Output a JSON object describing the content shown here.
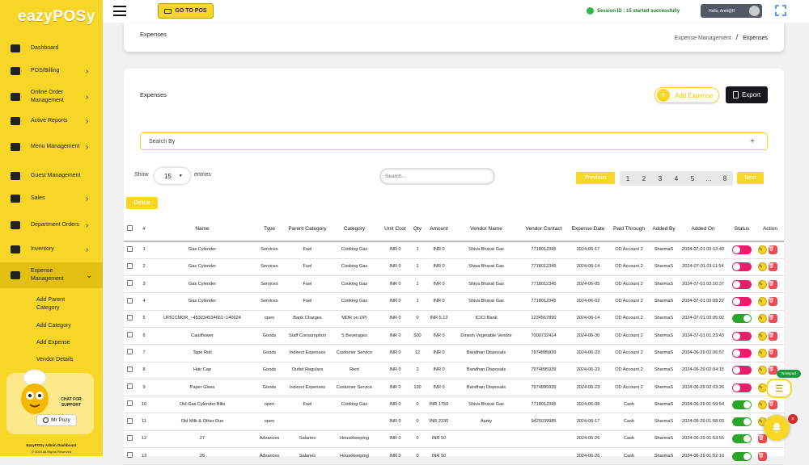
{
  "brand": {
    "logo_text": "eazyPOSy"
  },
  "sidebar": {
    "items": [
      {
        "label": "Dashboard",
        "icon": "monitor-icon"
      },
      {
        "label": "POS/Billing",
        "icon": "billing-icon"
      },
      {
        "label": "Online Order Management",
        "icon": "delivery-scooter-icon"
      },
      {
        "label": "Active Reports",
        "icon": "pie-chart-icon"
      },
      {
        "label": "Menu Management",
        "icon": "menu-list-icon"
      },
      {
        "label": "Guest Management",
        "icon": "guest-list-icon"
      },
      {
        "label": "Sales",
        "icon": "coins-icon"
      },
      {
        "label": "Department Orders",
        "icon": "building-icon"
      },
      {
        "label": "Inventory",
        "icon": "boxes-icon"
      },
      {
        "label": "Expense Management",
        "icon": "expense-hand-icon"
      }
    ],
    "subitems": [
      "Add Parent Category",
      "Add Category",
      "Add Expense",
      "Vendor Details"
    ],
    "support": {
      "chat_text": "CHAT FOR SUPPORT",
      "button_label": "Mr Pozy"
    },
    "footer_title": "EazyPOSy Admin Dashboard",
    "footer_copyright": "© 2024 All Rights Reserved"
  },
  "topbar": {
    "go_to_pos": "GO TO POS",
    "session_text": "Session ID : 15 started successfully",
    "user_greeting": "Hello, Amit@R"
  },
  "breadcrumb": {
    "title": "Expenses",
    "parent": "Expense Management",
    "separator": "/",
    "current": "Expenses"
  },
  "main": {
    "title": "Expenses",
    "add_expense_label": "Add Expense",
    "export_label": "Export",
    "search_by_label": "Search By",
    "show_label": "Show",
    "page_size": "15",
    "entries_label": "entries",
    "table_search_placeholder": "Search...",
    "previous_label": "Previous",
    "pages": [
      "1",
      "2",
      "3",
      "4",
      "5",
      "…",
      "8"
    ],
    "next_label": "Next",
    "delete_label": "Delete"
  },
  "table": {
    "columns": [
      "#",
      "Name",
      "Type",
      "Parent Category",
      "Category",
      "Unit Cost",
      "Qty",
      "Amount",
      "Vendor Name",
      "Vendor Contact",
      "Expense Date",
      "Paid Through",
      "Added By",
      "Added On",
      "Status",
      "Action"
    ],
    "rows": [
      {
        "n": "1",
        "name": "Gas Cylender",
        "type": "Services",
        "parent": "Fuel",
        "cat": "Cooking Gas",
        "unit": "INR 0",
        "qty": "1",
        "amount": "INR 0",
        "vendor": "Shiva Bharat Gas",
        "contact": "7718012345",
        "date": "2024-06-17",
        "paid": "OD Account 2",
        "by": "SharmaS",
        "on": "2024-07-01 03:12:40",
        "status": "off"
      },
      {
        "n": "2",
        "name": "Gas Cylender",
        "type": "Services",
        "parent": "Fuel",
        "cat": "Cooking Gas",
        "unit": "INR 0",
        "qty": "1",
        "amount": "INR 0",
        "vendor": "Shiva Bharat Gas",
        "contact": "7718012345",
        "date": "2024-06-14",
        "paid": "OD Account 2",
        "by": "SharmaS",
        "on": "2024-07-01 03:11:54",
        "status": "off"
      },
      {
        "n": "3",
        "name": "Gas Cylender",
        "type": "Services",
        "parent": "Fuel",
        "cat": "Cooking Gas",
        "unit": "INR 0",
        "qty": "1",
        "amount": "INR 0",
        "vendor": "Shiva Bharat Gas",
        "contact": "7718012345",
        "date": "2024-06-05",
        "paid": "OD Account 2",
        "by": "SharmaS",
        "on": "2024-07-01 03:10:37",
        "status": "off"
      },
      {
        "n": "4",
        "name": "Gas Cylender",
        "type": "Services",
        "parent": "Fuel",
        "cat": "Cooking Gas",
        "unit": "INR 0",
        "qty": "1",
        "amount": "INR 0",
        "vendor": "Shiva Bharat Gas",
        "contact": "7718012345",
        "date": "2024-06-02",
        "paid": "OD Account 2",
        "by": "SharmaS",
        "on": "2024-07-01 03:09:22",
        "status": "off"
      },
      {
        "n": "5",
        "name": "UPICCMDR_~453234534661~140624",
        "type": "open",
        "parent": "Bank Charges",
        "cat": "MDR on UPI",
        "unit": "INR 0",
        "qty": "0",
        "amount": "INR 5.13",
        "vendor": "ICICI Bank",
        "contact": "1234567890",
        "date": "2024-06-14",
        "paid": "OD Account 2",
        "by": "SharmaS",
        "on": "2024-07-01 03:05:02",
        "status": "on"
      },
      {
        "n": "6",
        "name": "Cauliflower",
        "type": "Goods",
        "parent": "Staff Consumption",
        "cat": "S Beverages",
        "unit": "INR 0",
        "qty": "500",
        "amount": "INR 0",
        "vendor": "Dinesh Vegetable Vendor",
        "contact": "7000732414",
        "date": "2024-06-30",
        "paid": "OD Account 2",
        "by": "SharmaS",
        "on": "2024-07-01 01:23:43",
        "status": "off"
      },
      {
        "n": "7",
        "name": "Tape Roll",
        "type": "Goods",
        "parent": "Indirect Expenses",
        "cat": "Customer Service",
        "unit": "INR 0",
        "qty": "12",
        "amount": "INR 0",
        "vendor": "Bandhan Disposals",
        "contact": "7974895939",
        "date": "2024-06-23",
        "paid": "OD Account 2",
        "by": "SharmaS",
        "on": "2024-06-29 02:06:57",
        "status": "off"
      },
      {
        "n": "8",
        "name": "Hair Cap",
        "type": "Goods",
        "parent": "Outlet Regulars",
        "cat": "Rent",
        "unit": "INR 0",
        "qty": "2",
        "amount": "INR 0",
        "vendor": "Bandhan Disposals",
        "contact": "7974895939",
        "date": "2024-06-23",
        "paid": "OD Account 2",
        "by": "SharmaS",
        "on": "2024-06-29 02:04:15",
        "status": "off"
      },
      {
        "n": "9",
        "name": "Paper Glass",
        "type": "Goods",
        "parent": "Indirect Expenses",
        "cat": "Customer Service",
        "unit": "INR 0",
        "qty": "120",
        "amount": "INR 0",
        "vendor": "Bandhan Disposals",
        "contact": "7974895939",
        "date": "2024-06-23",
        "paid": "OD Account 2",
        "by": "SharmaS",
        "on": "2024-06-29 02:03:26",
        "status": "off"
      },
      {
        "n": "10",
        "name": "Old Gas Cylender Bills",
        "type": "open",
        "parent": "Fuel",
        "cat": "Cooking Gas",
        "unit": "INR 0",
        "qty": "0",
        "amount": "INR 1750",
        "vendor": "Shiva Bharat Gas",
        "contact": "7718012345",
        "date": "2024-06-08",
        "paid": "Cash",
        "by": "SharmaS",
        "on": "2024-06-29 01:59:54",
        "status": "on"
      },
      {
        "n": "11",
        "name": "Old Milk & Other Due",
        "type": "open",
        "parent": "",
        "cat": "",
        "unit": "INR 0",
        "qty": "0",
        "amount": "INR 2330",
        "vendor": "Aunty",
        "contact": "9425039985",
        "date": "2024-06-17",
        "paid": "Cash",
        "by": "SharmaS",
        "on": "2024-06-29 01:58:03",
        "status": "on"
      },
      {
        "n": "12",
        "name": "27",
        "type": "Advances",
        "parent": "Salaries",
        "cat": "Housekeeping",
        "unit": "INR 0",
        "qty": "0",
        "amount": "INR 50",
        "vendor": "",
        "contact": "",
        "date": "2024-06-26",
        "paid": "Cash",
        "by": "SharmaS",
        "on": "2024-06-29 01:53:55",
        "status": "on"
      },
      {
        "n": "13",
        "name": "26",
        "type": "Advances",
        "parent": "Salaries",
        "cat": "Housekeeping",
        "unit": "INR 0",
        "qty": "0",
        "amount": "INR 50",
        "vendor": "",
        "contact": "",
        "date": "2024-06-26",
        "paid": "Cash",
        "by": "SharmaS",
        "on": "2024-06-29 01:52:10",
        "status": "on"
      }
    ]
  },
  "widgets": {
    "notepad_label": "Notepad"
  },
  "colors": {
    "accent": "#f8d628",
    "toggle_on": "#29a529",
    "toggle_off": "#ec1d6d",
    "danger": "#ec4a55"
  }
}
